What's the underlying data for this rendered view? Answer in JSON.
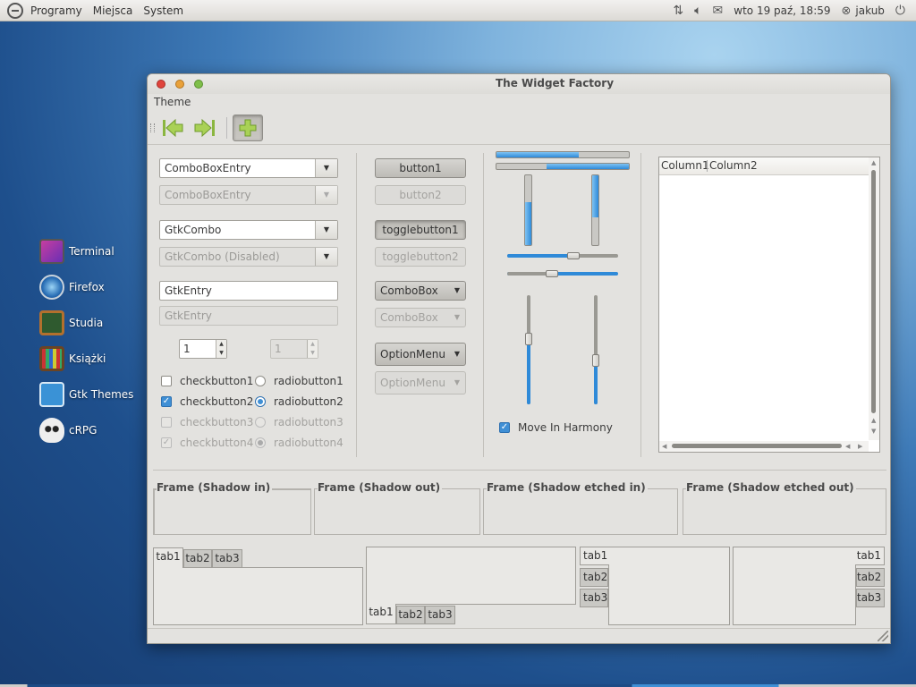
{
  "panel": {
    "menus": [
      "Programy",
      "Miejsca",
      "System"
    ],
    "datetime": "wto 19 paź, 18:59",
    "user": "jakub",
    "icons": [
      "ubuntu-logo-icon",
      "network-icon",
      "volume-icon",
      "mail-icon",
      "user-status-icon",
      "power-icon"
    ]
  },
  "desktop": {
    "launchers": [
      {
        "label": "Terminal",
        "icon": "terminal-icon"
      },
      {
        "label": "Firefox",
        "icon": "firefox-icon"
      },
      {
        "label": "Studia",
        "icon": "chalkboard-icon"
      },
      {
        "label": "Książki",
        "icon": "bookshelf-icon"
      },
      {
        "label": "Gtk Themes",
        "icon": "gtk-themes-icon"
      },
      {
        "label": "cRPG",
        "icon": "skull-icon"
      }
    ]
  },
  "window": {
    "title": "The Widget Factory",
    "menu": "Theme",
    "toolbar": [
      "go-first-icon",
      "go-last-icon",
      "add-icon"
    ]
  },
  "col1": {
    "combobox_entry": "ComboBoxEntry",
    "combobox_entry_disabled": "ComboBoxEntry",
    "gtkcombo": "GtkCombo",
    "gtkcombo_disabled": "GtkCombo (Disabled)",
    "entry": "GtkEntry",
    "entry_disabled": "GtkEntry",
    "spin": "1",
    "spin_disabled": "1",
    "checks": [
      {
        "label": "checkbutton1",
        "checked": false,
        "disabled": false
      },
      {
        "label": "checkbutton2",
        "checked": true,
        "disabled": false
      },
      {
        "label": "checkbutton3",
        "checked": false,
        "disabled": true
      },
      {
        "label": "checkbutton4",
        "checked": true,
        "disabled": true
      }
    ],
    "radios": [
      {
        "label": "radiobutton1",
        "checked": false,
        "disabled": false
      },
      {
        "label": "radiobutton2",
        "checked": true,
        "disabled": false
      },
      {
        "label": "radiobutton3",
        "checked": false,
        "disabled": true
      },
      {
        "label": "radiobutton4",
        "checked": true,
        "disabled": true
      }
    ]
  },
  "col2": {
    "button1": "button1",
    "button2": "button2",
    "togglebutton1": "togglebutton1",
    "togglebutton2": "togglebutton2",
    "combobox": "ComboBox",
    "combobox_disabled": "ComboBox",
    "optionmenu": "OptionMenu",
    "optionmenu_disabled": "OptionMenu"
  },
  "col3": {
    "progress_h1": 0.62,
    "progress_h2": 0.62,
    "progress_v1": 0.62,
    "progress_v2": 0.6,
    "hscale1": 0.6,
    "hscale2": 0.4,
    "vscale1": 0.6,
    "vscale2": 0.4,
    "harmony_label": "Move In Harmony",
    "harmony_checked": true
  },
  "tree": {
    "columns": [
      "Column1",
      "Column2"
    ]
  },
  "frames": [
    "Frame (Shadow in)",
    "Frame (Shadow out)",
    "Frame (Shadow etched in)",
    "Frame (Shadow etched out)"
  ],
  "notebooks": {
    "tabs": [
      "tab1",
      "tab2",
      "tab3"
    ]
  },
  "colors": {
    "accent": "#2f8ad8",
    "window_bg": "#e3e2df"
  }
}
